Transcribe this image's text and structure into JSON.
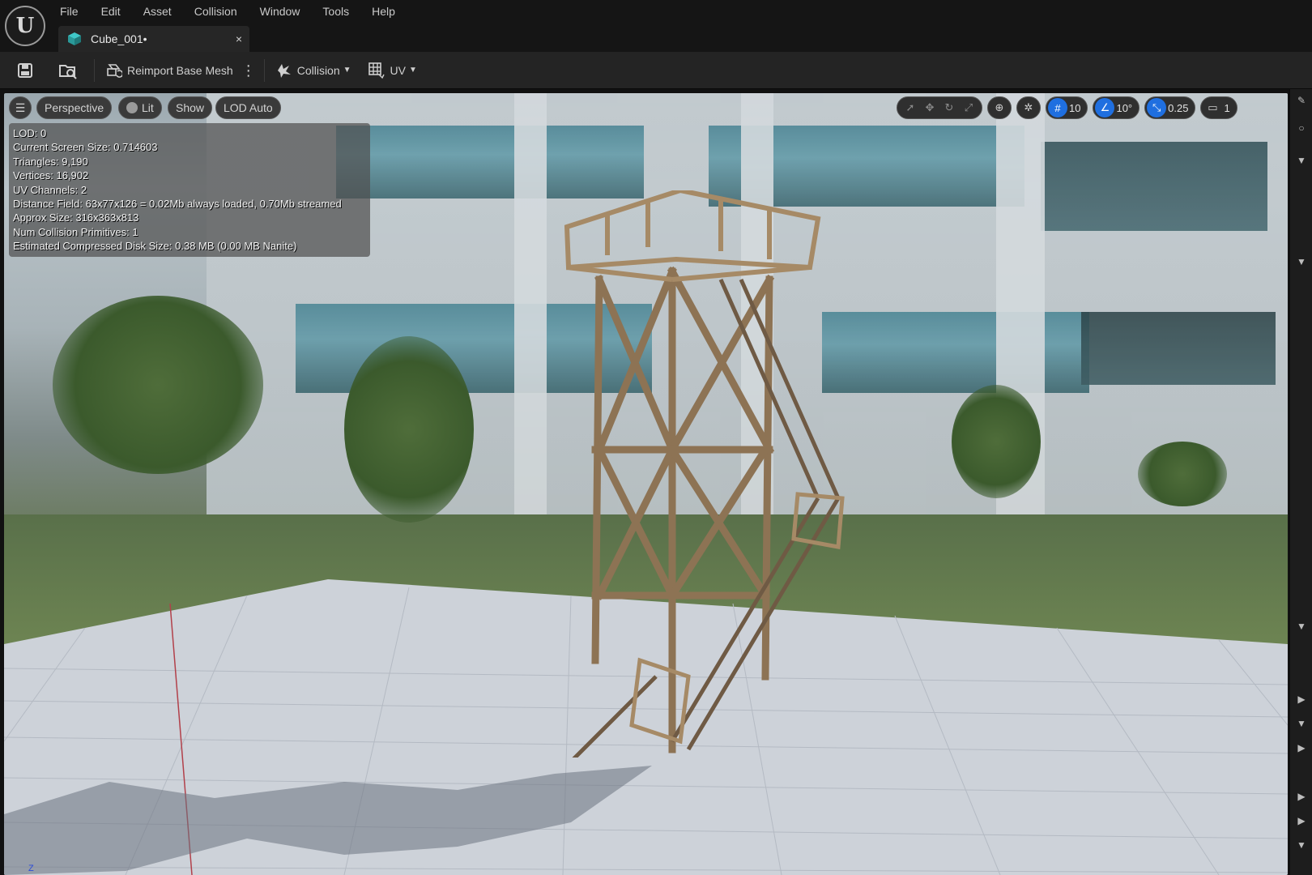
{
  "menu": [
    "File",
    "Edit",
    "Asset",
    "Collision",
    "Window",
    "Tools",
    "Help"
  ],
  "tab": {
    "title": "Cube_001•",
    "close": "×"
  },
  "toolbar": {
    "reimport_label": "Reimport Base Mesh",
    "collision_label": "Collision",
    "uv_label": "UV"
  },
  "viewport": {
    "mode_label": "Perspective",
    "lit_label": "Lit",
    "show_label": "Show",
    "lod_label": "LOD Auto",
    "grid_snap": "10",
    "rotation_snap": "10°",
    "scale_snap": "0.25",
    "camera_speed": "1",
    "axis_label": "Z"
  },
  "stats": [
    "LOD:  0",
    "Current Screen Size:  0.714603",
    "Triangles:  9,190",
    "Vertices:  16,902",
    "UV Channels:  2",
    "Distance Field:  63x77x126 = 0.02Mb always loaded, 0.70Mb streamed",
    "Approx Size: 316x363x813",
    "Num Collision Primitives:  1",
    "Estimated Compressed Disk Size: 0.38 MB (0.00 MB Nanite)"
  ],
  "colors": {
    "accent_blue": "#1f6fe0",
    "tab_icon": "#3fc7c7"
  }
}
